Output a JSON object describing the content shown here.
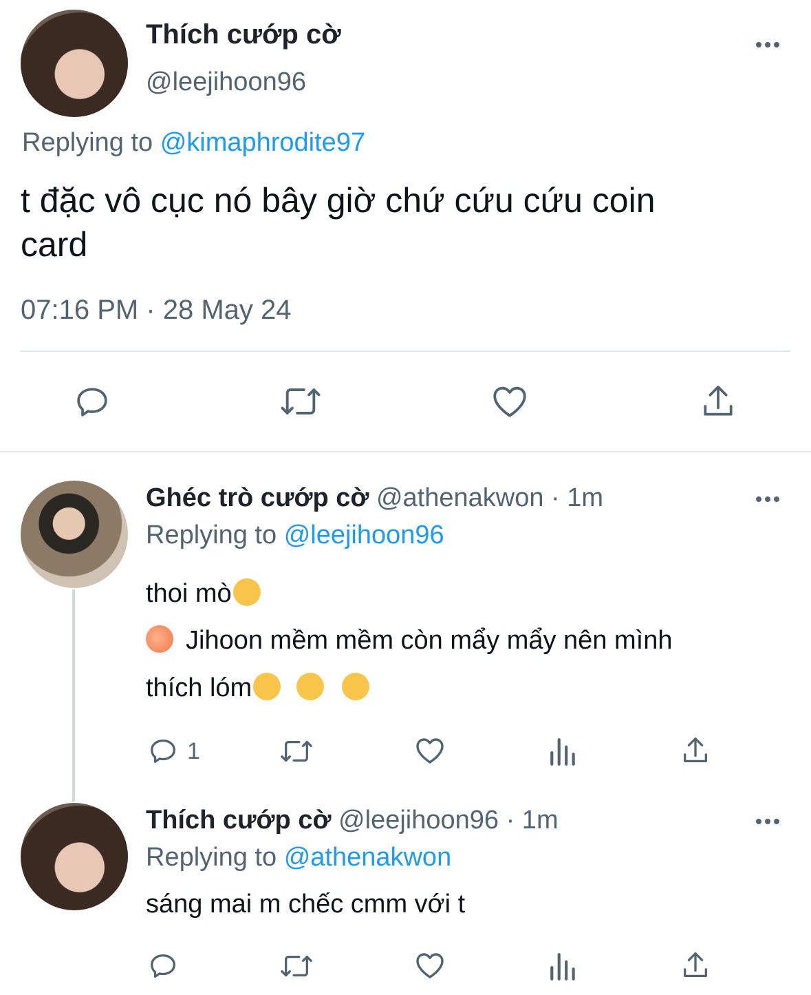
{
  "main_tweet": {
    "display_name": "Thích cướp cờ",
    "handle": "@leejihoon96",
    "replying_prefix": "Replying to",
    "replying_to": "@kimaphrodite97",
    "text_line1": "t đặc vô cục nó bây giờ chứ cứu cứu coin",
    "text_line2": "card",
    "timestamp": "07:16 PM · 28 May 24"
  },
  "replies": [
    {
      "display_name": "Ghéc trò cướp cờ",
      "handle": "@athenakwon",
      "time": "· 1m",
      "replying_prefix": "Replying to",
      "replying_to": "@leejihoon96",
      "line1": "thoi mò",
      "line2": "Jihoon mềm mềm còn mẩy mẩy nên mình",
      "line3": "thích lóm",
      "reply_count": "1"
    },
    {
      "display_name": "Thích cướp cờ",
      "handle": "@leejihoon96",
      "time": "· 1m",
      "replying_prefix": "Replying to",
      "replying_to": "@athenakwon",
      "line1": "sáng mai m chếc cmm với t"
    }
  ],
  "icons": [
    "reply-icon",
    "retweet-icon",
    "like-icon",
    "share-icon",
    "views-icon",
    "more-icon"
  ],
  "colors": {
    "link": "#1d9bf0",
    "secondary": "#536471",
    "divider": "#e1e6ea",
    "icon": "#536471"
  }
}
